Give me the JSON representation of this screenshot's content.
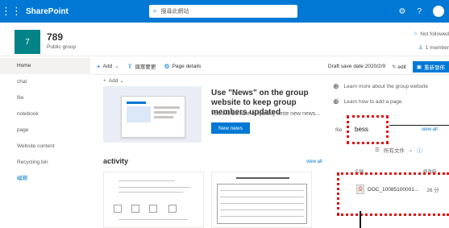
{
  "suite": {
    "app_name": "SharePoint",
    "search_placeholder": "搜尋此網站",
    "settings_icon": "gear-icon",
    "help_label": "?"
  },
  "site": {
    "logo_text": "7",
    "title": "789",
    "subtitle": "Public group",
    "follow_label": "Not followed",
    "member_label": "1 member"
  },
  "nav": {
    "items": [
      {
        "label": "Home"
      },
      {
        "label": "chat"
      },
      {
        "label": "file"
      },
      {
        "label": "notebook"
      },
      {
        "label": "page"
      },
      {
        "label": "Website content"
      },
      {
        "label": "Recycling bin"
      },
      {
        "label": "编辑"
      }
    ]
  },
  "commands": {
    "add_label": "Add",
    "share_label": "與眾要更",
    "details_label": "Page details",
    "draft_label": "Draft save date 2020/2/9",
    "edit_label": "edit",
    "publish_label": "重新發佈"
  },
  "main": {
    "add_label": "Add",
    "news_title": "Use \"News\" on the group website to keep group members updated",
    "news_desc": "You will be able to quickly write new news...",
    "news_button": "New news",
    "activity_title": "activity",
    "activity_view_all": "view all"
  },
  "right": {
    "learn_site": "Learn more about the group website",
    "learn_page": "Learn how to add a page",
    "files_label": "file",
    "files_view_all": "view all",
    "annotation_text": "bess",
    "all_files_label": "所有文件",
    "header_name": "名稱",
    "header_modified": "修改時",
    "file_name": "DOC_10085100001...",
    "file_time": "26 分",
    "file_icon_text": "PDF"
  },
  "colors": {
    "brand": "#0078d4",
    "site_logo": "#038387",
    "annotation": "#e01010"
  }
}
